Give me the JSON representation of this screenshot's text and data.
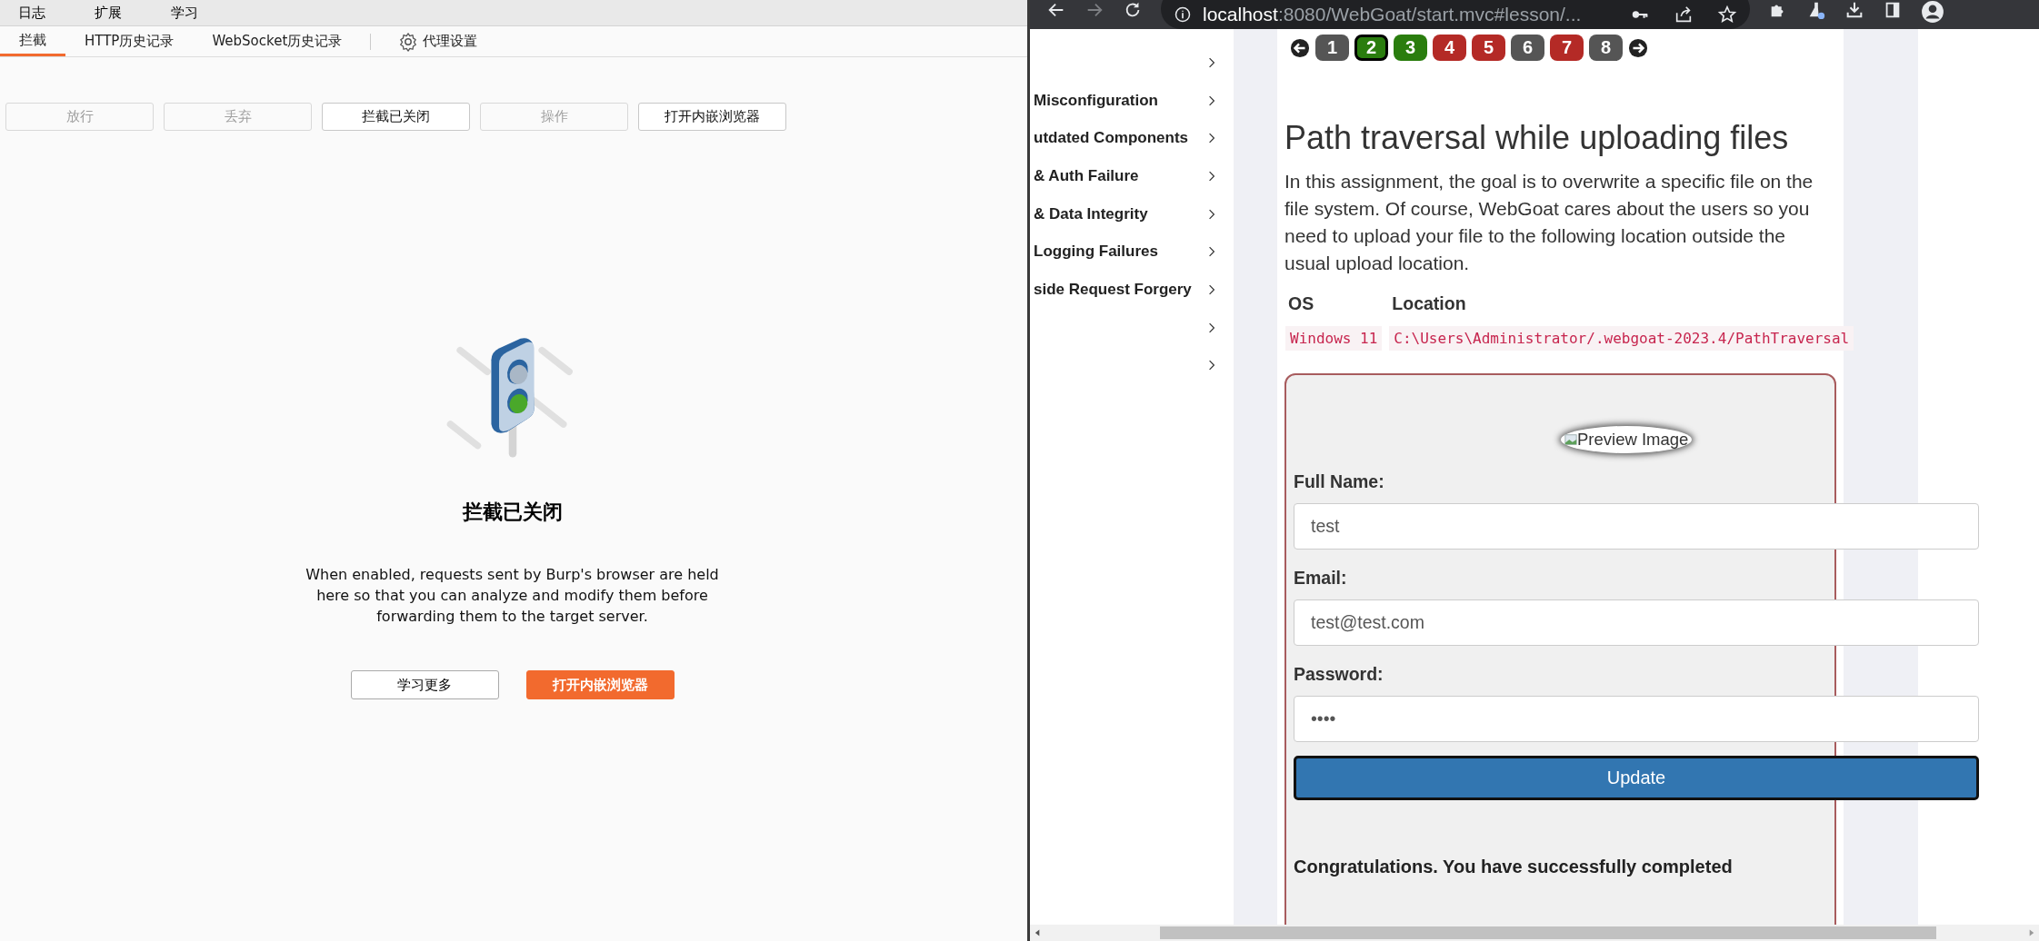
{
  "burp": {
    "menu": [
      "日志",
      "扩展",
      "学习"
    ],
    "tabs": [
      {
        "label": "拦截",
        "selected": true
      },
      {
        "label": "HTTP历史记录",
        "selected": false
      },
      {
        "label": "WebSocket历史记录",
        "selected": false
      }
    ],
    "settings_tab": "代理设置",
    "toolbar": [
      {
        "label": "放行",
        "disabled": true
      },
      {
        "label": "丢弃",
        "disabled": true
      },
      {
        "label": "拦截已关闭",
        "disabled": false
      },
      {
        "label": "操作",
        "disabled": true
      },
      {
        "label": "打开内嵌浏览器",
        "disabled": false
      }
    ],
    "empty_state": {
      "title": "拦截已关闭",
      "description": "When enabled, requests sent by Burp's browser are held here so that you can analyze and modify them before forwarding them to the target server.",
      "buttons": [
        {
          "label": "学习更多",
          "kind": "secondary"
        },
        {
          "label": "打开内嵌浏览器",
          "kind": "primary"
        }
      ]
    }
  },
  "browser": {
    "url_host": "localhost",
    "url_rest": ":8080/WebGoat/start.mvc#lesson/...",
    "sidebar": [
      {
        "kind": "category"
      },
      {
        "kind": "category",
        "label": "Misconfiguration"
      },
      {
        "kind": "category",
        "label": "utdated Components"
      },
      {
        "kind": "category",
        "label": "& Auth Failure"
      },
      {
        "kind": "category",
        "label": "& Data Integrity"
      },
      {
        "kind": "category",
        "label": "Logging Failures"
      },
      {
        "kind": "category",
        "label": "side Request Forgery"
      },
      {
        "kind": "category"
      },
      {
        "kind": "category"
      }
    ],
    "pages": [
      {
        "label": "1",
        "color": "#555555",
        "selected": false
      },
      {
        "label": "2",
        "color": "#2a7d0e",
        "selected": true
      },
      {
        "label": "3",
        "color": "#2a7d0e",
        "selected": false
      },
      {
        "label": "4",
        "color": "#b42a26",
        "selected": false
      },
      {
        "label": "5",
        "color": "#b42a26",
        "selected": false
      },
      {
        "label": "6",
        "color": "#555555",
        "selected": false
      },
      {
        "label": "7",
        "color": "#b42a26",
        "selected": false
      },
      {
        "label": "8",
        "color": "#555555",
        "selected": false
      }
    ],
    "title": "Path traversal while uploading files",
    "intro": "In this assignment, the goal is to overwrite a specific file on the file system. Of course, WebGoat cares about the users so you need to upload your file to the following location outside the usual upload location.",
    "table": {
      "columns": [
        "OS",
        "Location"
      ],
      "rows": [
        [
          "Windows 11",
          "C:\\Users\\Administrator/.webgoat-2023.4/PathTraversal"
        ]
      ]
    },
    "form": {
      "preview_alt": "Preview Image",
      "fields": [
        {
          "label": "Full Name:",
          "value": "test"
        },
        {
          "label": "Email:",
          "value": "test@test.com"
        },
        {
          "label": "Password:",
          "value": "••••"
        }
      ],
      "submit": "Update",
      "message": "Congratulations. You have successfully completed"
    }
  }
}
